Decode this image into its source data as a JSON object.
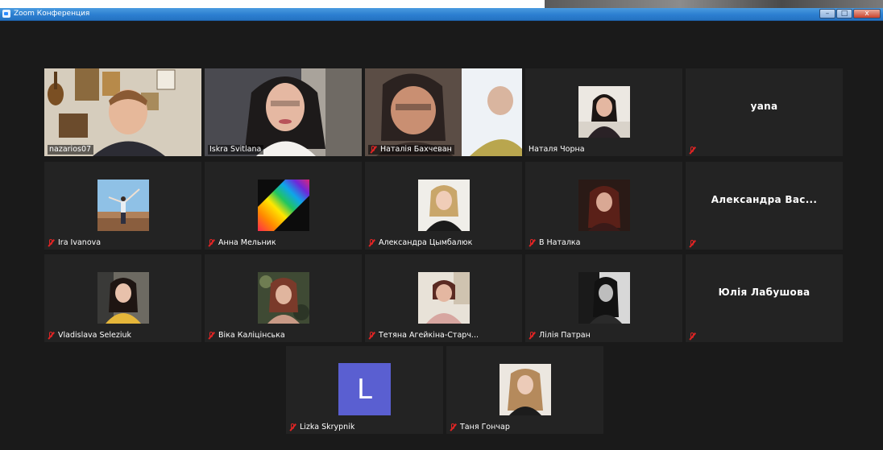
{
  "window": {
    "title": "Zoom Конференция",
    "controls": {
      "minimize": "–",
      "maximize": "□",
      "close": "x"
    }
  },
  "colors": {
    "active_speaker_border": "#d8e84a",
    "muted_icon": "#e02424",
    "tile_background": "#232323",
    "letter_avatar": "#5a5fd1",
    "title_bar": "#2c7fd0"
  },
  "participants": [
    {
      "name": "nazarios07",
      "kind": "video",
      "muted": false,
      "active": true
    },
    {
      "name": "Iskra Svitlana",
      "kind": "video",
      "muted": false
    },
    {
      "name": "Наталія Бахчеван",
      "kind": "video",
      "muted": true
    },
    {
      "name": "Наталя Чорна",
      "kind": "photo",
      "muted": false
    },
    {
      "name": "",
      "center_label": "yana",
      "kind": "text",
      "muted": true
    },
    {
      "name": "Ira Ivanova",
      "kind": "photo",
      "muted": true
    },
    {
      "name": "Анна Мельник",
      "kind": "photo",
      "muted": true
    },
    {
      "name": "Александра Цымбалюк",
      "kind": "photo",
      "muted": true
    },
    {
      "name": "В Наталка",
      "kind": "photo",
      "muted": true
    },
    {
      "name": "",
      "center_label": "Александра Вас...",
      "kind": "text",
      "muted": true
    },
    {
      "name": "Vladislava Seleziuk",
      "kind": "photo",
      "muted": true
    },
    {
      "name": "Віка Каліцінська",
      "kind": "photo",
      "muted": true
    },
    {
      "name": "Тетяна Агейкіна-Старч...",
      "kind": "photo",
      "muted": true
    },
    {
      "name": "Лілія Патран",
      "kind": "photo",
      "muted": true
    },
    {
      "name": "",
      "center_label": "Юлія Лабушова",
      "kind": "text",
      "muted": true
    },
    {
      "name": "Lizka Skrypnik",
      "kind": "letter",
      "letter": "L",
      "muted": true
    },
    {
      "name": "Таня Гончар",
      "kind": "photo",
      "muted": true
    }
  ]
}
